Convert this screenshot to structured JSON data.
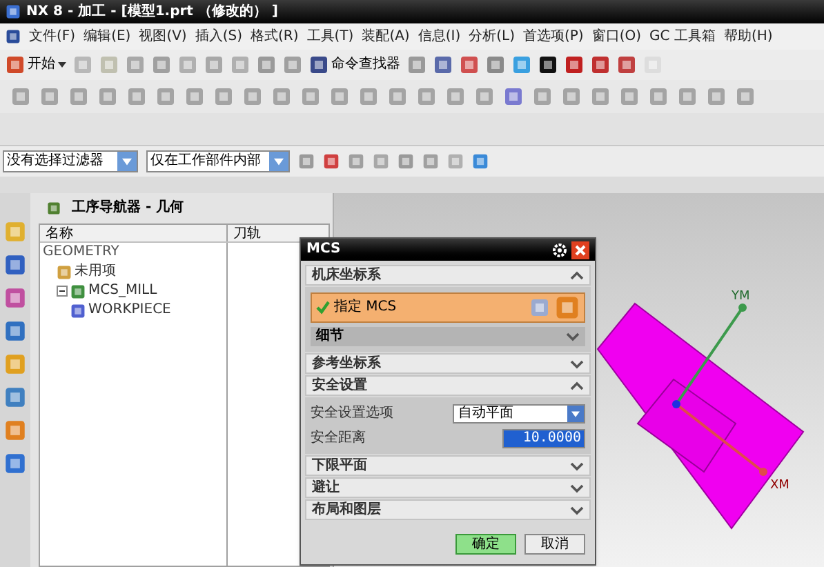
{
  "window": {
    "title": "NX 8 - 加工 - [模型1.prt （修改的） ]"
  },
  "menu": [
    "文件(F)",
    "编辑(E)",
    "视图(V)",
    "插入(S)",
    "格式(R)",
    "工具(T)",
    "装配(A)",
    "信息(I)",
    "分析(L)",
    "首选项(P)",
    "窗口(O)",
    "GC 工具箱",
    "帮助(H)"
  ],
  "toolbar": {
    "start": "开始",
    "command_finder": "命令查找器"
  },
  "filter_bar": {
    "selection_filter": "没有选择过滤器",
    "scope": "仅在工作部件内部"
  },
  "navigator": {
    "title": "工序导航器 - 几何",
    "columns": [
      "名称",
      "刀轨"
    ],
    "tree": [
      {
        "label": "GEOMETRY",
        "kind": "root",
        "children": [
          {
            "label": "未用项",
            "kind": "group"
          },
          {
            "label": "MCS_MILL",
            "kind": "mcs",
            "expanded": true,
            "children": [
              {
                "label": "WORKPIECE",
                "kind": "workpiece"
              }
            ]
          }
        ]
      }
    ]
  },
  "dialog": {
    "title": "MCS",
    "sections": [
      {
        "label": "机床坐标系",
        "expanded": true,
        "rows": [
          {
            "kind": "specify",
            "label": "指定 MCS",
            "checked": true
          },
          {
            "kind": "subsection",
            "label": "细节",
            "expanded": false
          }
        ]
      },
      {
        "label": "参考坐标系",
        "expanded": false
      },
      {
        "label": "安全设置",
        "expanded": true,
        "rows": [
          {
            "kind": "dropdown",
            "label": "安全设置选项",
            "value": "自动平面"
          },
          {
            "kind": "number",
            "label": "安全距离",
            "value": "10.0000"
          }
        ]
      },
      {
        "label": "下限平面",
        "expanded": false
      },
      {
        "label": "避让",
        "expanded": false
      },
      {
        "label": "布局和图层",
        "expanded": false
      }
    ],
    "buttons": [
      {
        "label": "确定",
        "default": true
      },
      {
        "label": "取消",
        "default": false
      }
    ]
  },
  "viewport": {
    "axes": [
      {
        "label": "YM",
        "color": "#3c9a4c"
      },
      {
        "label": "XM",
        "color": "#e04a4a"
      }
    ]
  }
}
